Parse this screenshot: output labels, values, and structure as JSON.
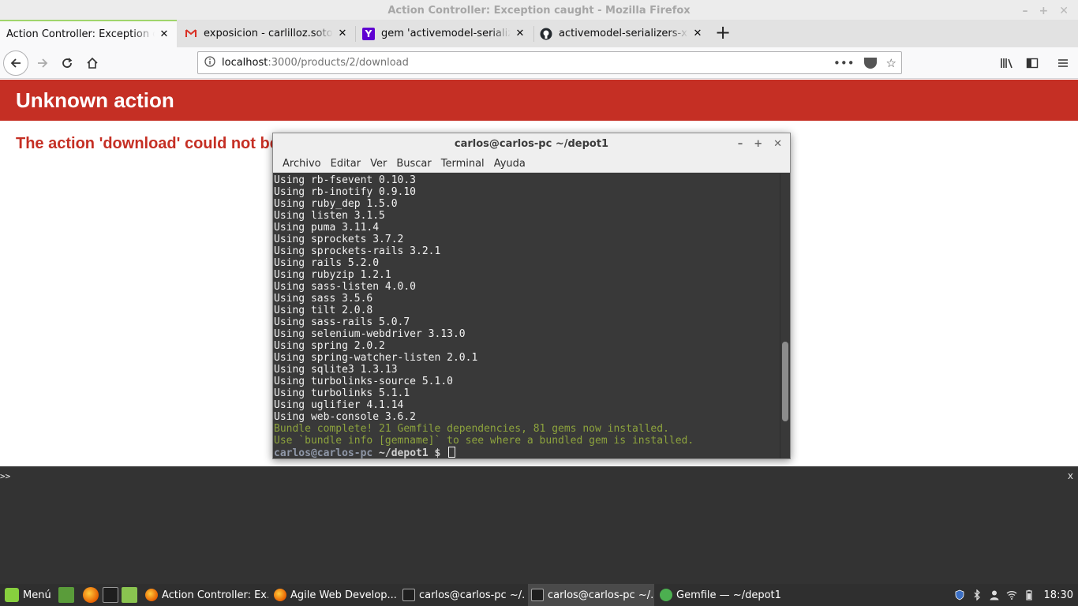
{
  "window": {
    "title": "Action Controller: Exception caught - Mozilla Firefox"
  },
  "tabs": [
    {
      "label": "Action Controller: Exception caught",
      "icon": "firefox-page-icon",
      "active": true
    },
    {
      "label": "exposicion - carlilloz.soto@gmail.com",
      "icon": "gmail-icon",
      "active": false
    },
    {
      "label": "gem 'activemodel-serializers-xml'",
      "icon": "yahoo-icon",
      "active": false
    },
    {
      "label": "activemodel-serializers-xml/README",
      "icon": "github-icon",
      "active": false
    }
  ],
  "navbar": {
    "url_host": "localhost",
    "url_rest": ":3000/products/2/download"
  },
  "page": {
    "error_title": "Unknown action",
    "error_message": "The action 'download' could not be"
  },
  "terminal": {
    "title": "carlos@carlos-pc ~/depot1",
    "menu": [
      "Archivo",
      "Editar",
      "Ver",
      "Buscar",
      "Terminal",
      "Ayuda"
    ],
    "lines": [
      "Using rb-fsevent 0.10.3",
      "Using rb-inotify 0.9.10",
      "Using ruby_dep 1.5.0",
      "Using listen 3.1.5",
      "Using puma 3.11.4",
      "Using sprockets 3.7.2",
      "Using sprockets-rails 3.2.1",
      "Using rails 5.2.0",
      "Using rubyzip 1.2.1",
      "Using sass-listen 4.0.0",
      "Using sass 3.5.6",
      "Using tilt 2.0.8",
      "Using sass-rails 5.0.7",
      "Using selenium-webdriver 3.13.0",
      "Using spring 2.0.2",
      "Using spring-watcher-listen 2.0.1",
      "Using sqlite3 1.3.13",
      "Using turbolinks-source 5.1.0",
      "Using turbolinks 5.1.1",
      "Using uglifier 4.1.14",
      "Using web-console 3.6.2"
    ],
    "success_lines": [
      "Bundle complete! 21 Gemfile dependencies, 81 gems now installed.",
      "Use `bundle info [gemname]` to see where a bundled gem is installed."
    ],
    "prompt_user": "carlos@carlos-pc",
    "prompt_path": " ~/depot1 $",
    "scroll_position": 0.82,
    "scroll_visible_fraction": 0.28
  },
  "console": {
    "prompt": ">>",
    "close": "x"
  },
  "taskbar": {
    "menu_label": "Menú",
    "tasks": [
      {
        "label": "Action Controller: Ex...",
        "icon": "firefox-icon",
        "active": false
      },
      {
        "label": "Agile Web Develop...",
        "icon": "firefox-icon",
        "active": false
      },
      {
        "label": "carlos@carlos-pc ~/...",
        "icon": "terminal-icon",
        "active": false
      },
      {
        "label": "carlos@carlos-pc ~/...",
        "icon": "terminal-icon",
        "active": true
      },
      {
        "label": "Gemfile — ~/depot1 ...",
        "icon": "gedit-icon",
        "active": false
      }
    ],
    "clock": "18:30"
  },
  "colors": {
    "error_red": "#c52f24",
    "terminal_bg": "#393939",
    "terminal_success": "#8da33d",
    "taskbar_bg": "#2f2f2f",
    "active_tab_accent": "#a0d56c"
  }
}
